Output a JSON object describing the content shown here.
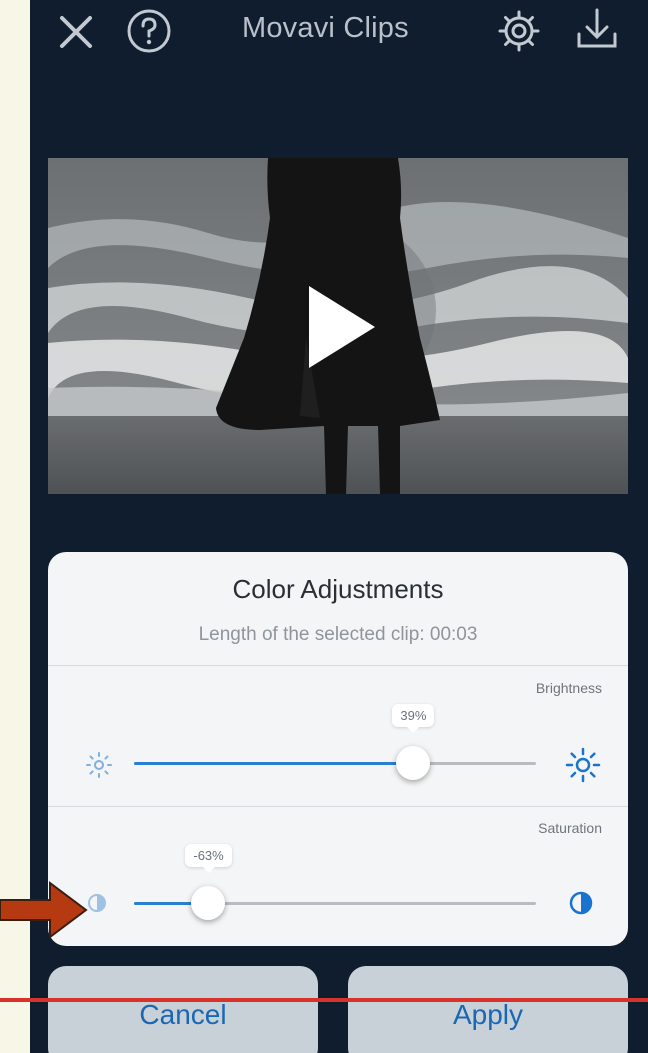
{
  "app": {
    "title": "Movavi Clips"
  },
  "panel": {
    "title": "Color Adjustments",
    "subtitle": "Length of the selected clip: 00:03",
    "brightness": {
      "label": "Brightness",
      "value_text": "39%",
      "level": 0.39
    },
    "saturation": {
      "label": "Saturation",
      "value_text": "-63%",
      "level": -0.63
    }
  },
  "buttons": {
    "cancel": "Cancel",
    "apply": "Apply"
  },
  "colors": {
    "accent": "#2a7fd1",
    "annotation_arrow": "#b53a12",
    "annotation_line": "#d7332a"
  },
  "icons": [
    "close-icon",
    "help-icon",
    "settings-gear-icon",
    "download-icon",
    "play-icon",
    "brightness-low-icon",
    "brightness-high-icon",
    "saturation-low-icon",
    "saturation-high-icon"
  ]
}
